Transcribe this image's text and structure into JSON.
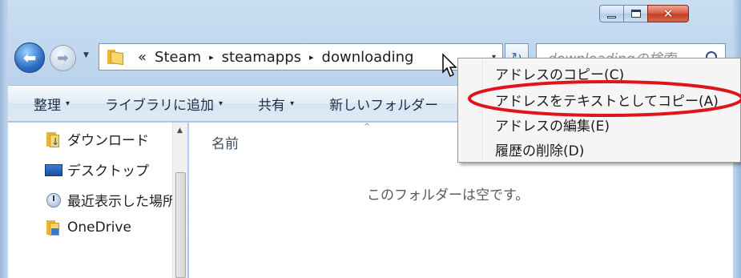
{
  "window": {
    "minimize_icon": "minimize-icon",
    "maximize_icon": "maximize-icon",
    "close_icon": "close-icon"
  },
  "nav": {
    "back_icon": "back-arrow-icon",
    "forward_icon": "forward-arrow-icon",
    "history_icon": "chevron-down-icon"
  },
  "address": {
    "lead": "«",
    "crumbs": [
      "Steam",
      "steamapps",
      "downloading"
    ],
    "sep": "▸",
    "dropdown": "▾"
  },
  "refresh": {
    "glyph": "↻"
  },
  "search": {
    "placeholder": "downloadingの検索"
  },
  "commands": [
    {
      "label": "整理",
      "arrow": "▾"
    },
    {
      "label": "ライブラリに追加",
      "arrow": "▾"
    },
    {
      "label": "共有",
      "arrow": "▾"
    },
    {
      "label": "新しいフォルダー",
      "arrow": ""
    }
  ],
  "navpane": {
    "items": [
      {
        "label": "ダウンロード",
        "icon": "downloads-folder-icon"
      },
      {
        "label": "デスクトップ",
        "icon": "desktop-icon"
      },
      {
        "label": "最近表示した場所",
        "icon": "recent-places-icon"
      },
      {
        "label": "OneDrive",
        "icon": "onedrive-folder-icon"
      }
    ],
    "scroll_up": "▲"
  },
  "filepane": {
    "column_name": "名前",
    "sort_caret": "^",
    "empty_message": "このフォルダーは空です。"
  },
  "context_menu": {
    "items": [
      "アドレスのコピー(C)",
      "アドレスをテキストとしてコピー(A)",
      "アドレスの編集(E)",
      "履歴の削除(D)"
    ]
  },
  "annotation": {
    "color": "#e0151c"
  }
}
